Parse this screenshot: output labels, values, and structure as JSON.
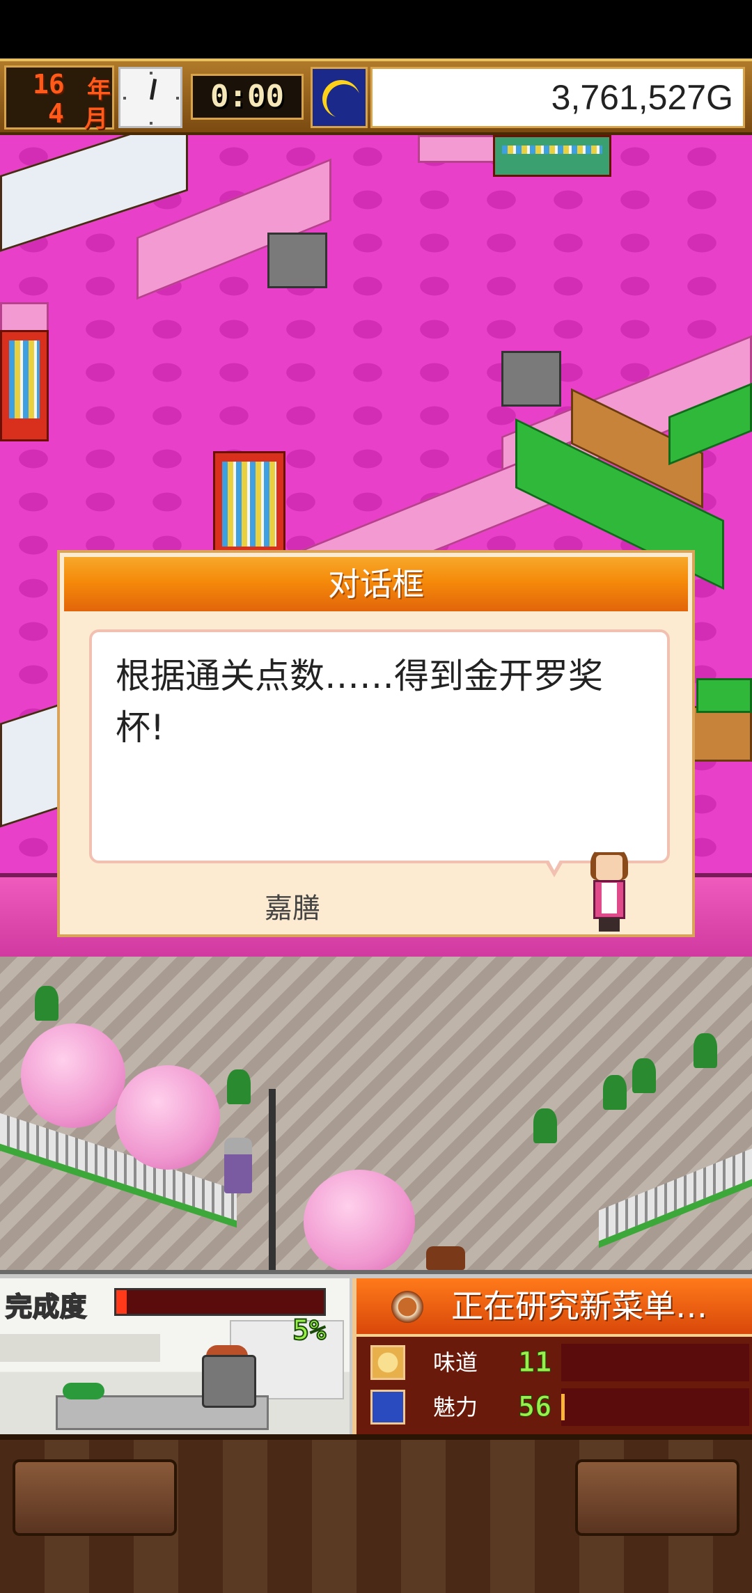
{
  "status_bar": {
    "year_number": "16",
    "year_unit": "年",
    "month_number": "4",
    "month_unit": "月",
    "time": "0:00",
    "money": "3,761,527G",
    "time_of_day_icon": "moon-icon"
  },
  "dialog": {
    "title": "对话框",
    "message": "根据通关点数……得到金开罗奖杯!",
    "speaker": "嘉膳"
  },
  "kitchen_panel": {
    "completion_label": "完成度",
    "progress_percent_label": "5%",
    "progress_fraction": 0.05
  },
  "research_panel": {
    "title": "正在研究新菜单…",
    "stats": [
      {
        "label": "味道",
        "value": "11",
        "icon": "taste-icon",
        "bar_fraction": 0.0
      },
      {
        "label": "魅力",
        "value": "56",
        "icon": "charm-icon",
        "bar_fraction": 0.02
      }
    ]
  },
  "colors": {
    "floor": "#e840c8",
    "dialog_header": "#f58a0a",
    "research_header": "#ff7a1a",
    "stat_value": "#9af04a"
  }
}
